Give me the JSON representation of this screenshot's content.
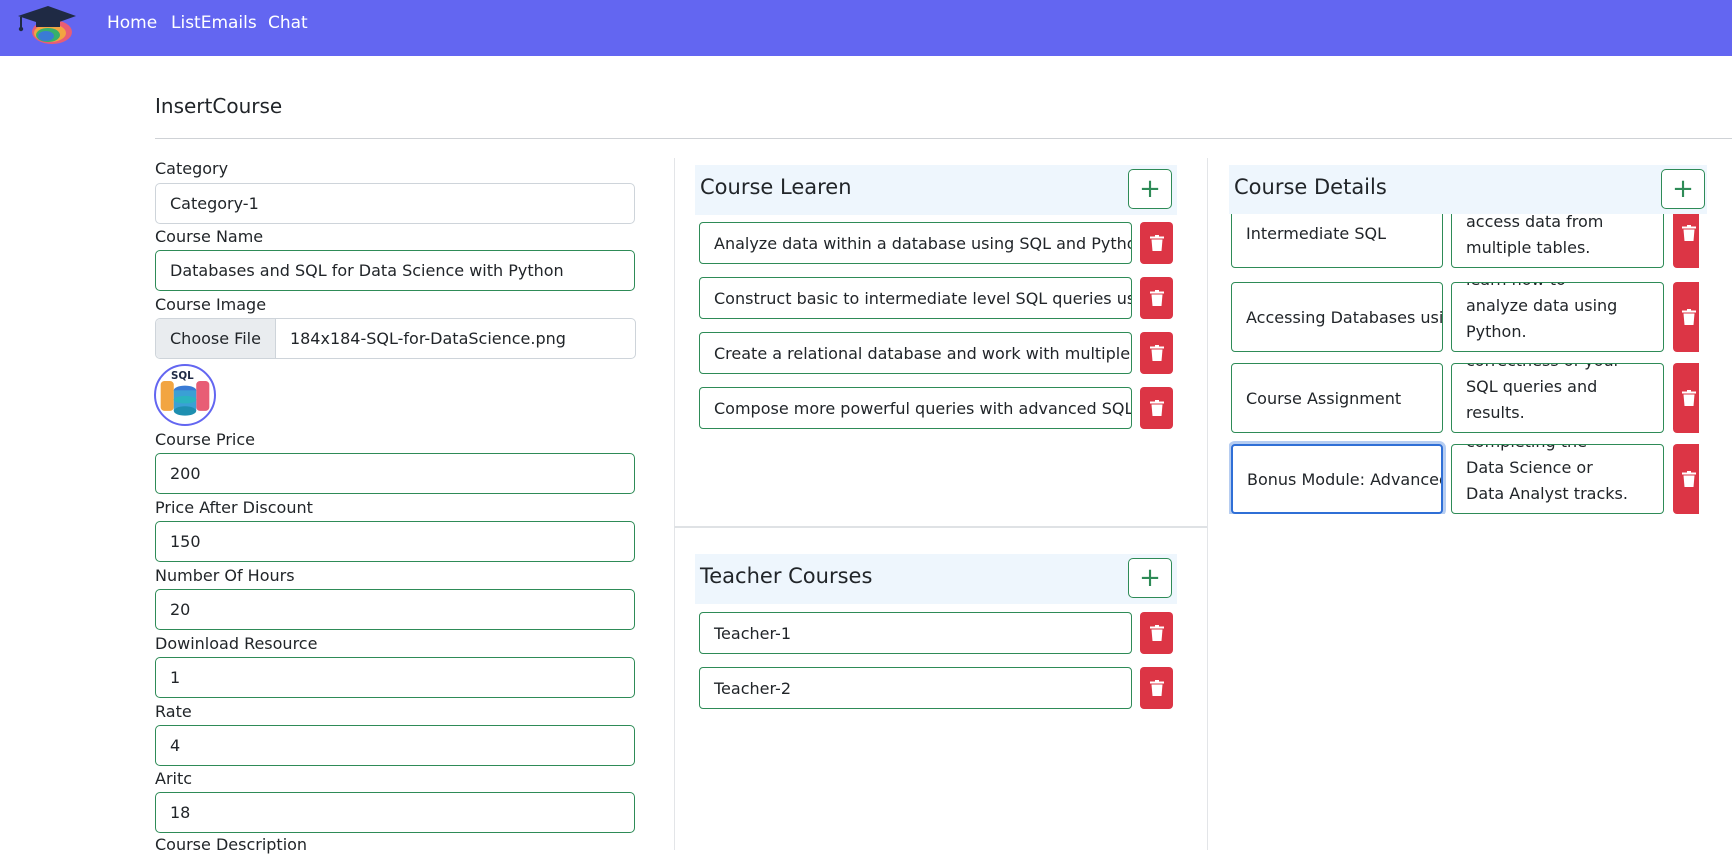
{
  "nav": {
    "logo": "graduation-cap-logo",
    "links": [
      "Home",
      "ListEmails",
      "Chat"
    ],
    "color": "#6366f1"
  },
  "page": {
    "title": "InsertCourse"
  },
  "form": {
    "category": {
      "label": "Category",
      "value": "Category-1"
    },
    "course_name": {
      "label": "Course Name",
      "value": "Databases and SQL for Data Science with Python"
    },
    "course_image": {
      "label": "Course Image",
      "button": "Choose File",
      "file_name": "184x184-SQL-for-DataScience.png",
      "preview_text": "SQL"
    },
    "course_price": {
      "label": "Course Price",
      "value": "200"
    },
    "price_after_discount": {
      "label": "Price After Discount",
      "value": "150"
    },
    "number_of_hours": {
      "label": "Number Of Hours",
      "value": "20"
    },
    "download_resource": {
      "label": "Dowinload Resource",
      "value": "1"
    },
    "rate": {
      "label": "Rate",
      "value": "4"
    },
    "aritc": {
      "label": "Aritc",
      "value": "18"
    },
    "course_description": {
      "label": "Course Description"
    }
  },
  "course_learn": {
    "title": "Course Learen",
    "add_icon": "plus-icon",
    "items": [
      "Analyze data within a database using SQL and Python",
      "Construct basic to intermediate level SQL queries using DML commands",
      "Create a relational database and work with multiple tables using DDL commands",
      "Compose more powerful queries with advanced SQL techniques"
    ]
  },
  "teacher_courses": {
    "title": "Teacher Courses",
    "add_icon": "plus-icon",
    "items": [
      "Teacher-1",
      "Teacher-2"
    ]
  },
  "course_details": {
    "title": "Course Details",
    "add_icon": "plus-icon",
    "rows": [
      {
        "title": "Intermediate SQL",
        "desc": [
          "access data from",
          "multiple tables."
        ]
      },
      {
        "title": "Accessing Databases using Python",
        "desc": [
          "learn how to",
          "analyze data using",
          "Python."
        ]
      },
      {
        "title": "Course Assignment",
        "desc": [
          "correctness of your",
          "SQL queries and",
          "results."
        ]
      },
      {
        "title": "Bonus Module: Advanced SQL",
        "desc": [
          "completing the",
          "Data Science or",
          "Data Analyst tracks."
        ]
      }
    ]
  },
  "colors": {
    "accent": "#6366f1",
    "success": "#2e8b57",
    "danger": "#dc3545",
    "focus": "#2f6fd6",
    "section_bg": "#eef6fd"
  },
  "icons": {
    "delete": "trash-icon"
  }
}
